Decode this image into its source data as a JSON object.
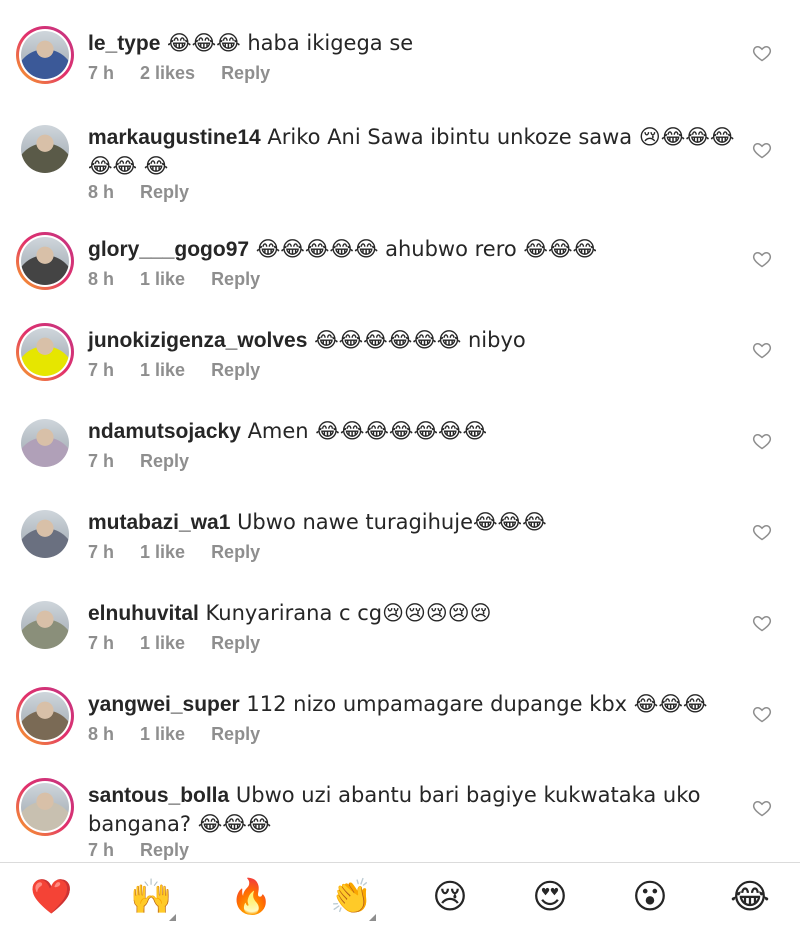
{
  "comments": [
    {
      "username": "le_type",
      "text": " 😂😂😂 haba ikigega se",
      "time": "7 h",
      "likes": "2 likes",
      "reply": "Reply",
      "story": true,
      "avatar_color": "#3b5998"
    },
    {
      "username": "markaugustine14",
      "text": " Ariko Ani Sawa ibintu unkoze sawa 😢😂😂😂😂😂 😂",
      "time": "8 h",
      "likes": "",
      "reply": "Reply",
      "story": false,
      "avatar_color": "#5a5a48"
    },
    {
      "username": "glory___gogo97",
      "text": " 😂😂😂😂😂 ahubwo rero 😂😂😂",
      "time": "8 h",
      "likes": "1 like",
      "reply": "Reply",
      "story": true,
      "avatar_color": "#444444"
    },
    {
      "username": "junokizigenza_wolves",
      "text": " 😂😂😂😂😂😂 nibyo",
      "time": "7 h",
      "likes": "1 like",
      "reply": "Reply",
      "story": true,
      "avatar_color": "#e6e600"
    },
    {
      "username": "ndamutsojacky",
      "text": " Amen 😂😂😂😂😂😂😂",
      "time": "7 h",
      "likes": "",
      "reply": "Reply",
      "story": false,
      "avatar_color": "#b0a0b8"
    },
    {
      "username": "mutabazi_wa1",
      "text": " Ubwo nawe turagihuje😂😂😂",
      "time": "7 h",
      "likes": "1 like",
      "reply": "Reply",
      "story": false,
      "avatar_color": "#6a7080"
    },
    {
      "username": "elnuhuvital",
      "text": " Kunyarirana c cg😢😢😢😢😢",
      "time": "7 h",
      "likes": "1 like",
      "reply": "Reply",
      "story": false,
      "avatar_color": "#8a8f7a"
    },
    {
      "username": "yangwei_super",
      "text": " 112 nizo umpamagare dupange kbx 😂😂😂",
      "time": "8 h",
      "likes": "1 like",
      "reply": "Reply",
      "story": true,
      "avatar_color": "#7a6a55"
    },
    {
      "username": "santous_bolla",
      "text": " Ubwo uzi abantu bari bagiye kukwataka uko bangana? 😂😂😂",
      "time": "7 h",
      "likes": "",
      "reply": "Reply",
      "story": true,
      "avatar_color": "#c8c0b0"
    }
  ],
  "reactions": [
    {
      "name": "heart-reaction",
      "glyph": "❤️",
      "has_more": false
    },
    {
      "name": "raised-hands-reaction",
      "glyph": "🙌",
      "has_more": true
    },
    {
      "name": "fire-reaction",
      "glyph": "🔥",
      "has_more": false
    },
    {
      "name": "clapping-reaction",
      "glyph": "👏",
      "has_more": true
    },
    {
      "name": "crying-reaction",
      "glyph": "😢",
      "has_more": false
    },
    {
      "name": "heart-eyes-reaction",
      "glyph": "😍",
      "has_more": false
    },
    {
      "name": "surprised-reaction",
      "glyph": "😮",
      "has_more": false
    },
    {
      "name": "laughing-reaction",
      "glyph": "😂",
      "has_more": false
    }
  ]
}
